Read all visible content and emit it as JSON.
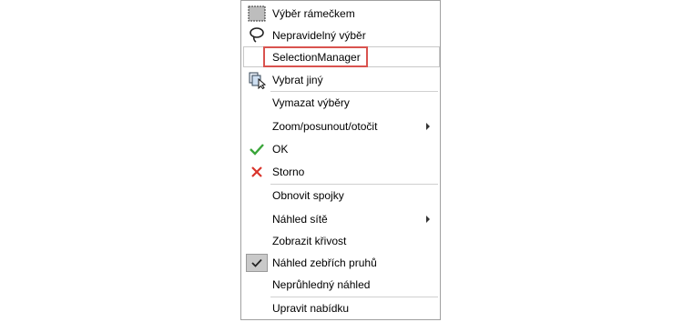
{
  "menu": {
    "items": [
      {
        "label": "Výběr rámečkem",
        "icon": "box-select-icon"
      },
      {
        "label": "Nepravidelný výběr",
        "icon": "lasso-icon"
      },
      {
        "label": "SelectionManager",
        "icon": ""
      },
      {
        "label": "Vybrat jiný",
        "icon": "select-other-icon"
      },
      {
        "label": "Vymazat výběry",
        "icon": ""
      },
      {
        "label": "Zoom/posunout/otočit",
        "icon": "",
        "submenu": true
      },
      {
        "label": "OK",
        "icon": "checkmark-icon"
      },
      {
        "label": "Storno",
        "icon": "cross-icon"
      },
      {
        "label": "Obnovit spojky",
        "icon": ""
      },
      {
        "label": "Náhled sítě",
        "icon": "",
        "submenu": true
      },
      {
        "label": "Zobrazit křivost",
        "icon": ""
      },
      {
        "label": "Náhled zebřích pruhů",
        "icon": "checkmark-icon",
        "checked": true
      },
      {
        "label": "Neprůhledný náhled",
        "icon": ""
      },
      {
        "label": "Upravit nabídku",
        "icon": ""
      }
    ]
  },
  "colors": {
    "ok_green": "#3aa53a",
    "cancel_red": "#d9342b",
    "highlight_red": "#d9534f"
  }
}
